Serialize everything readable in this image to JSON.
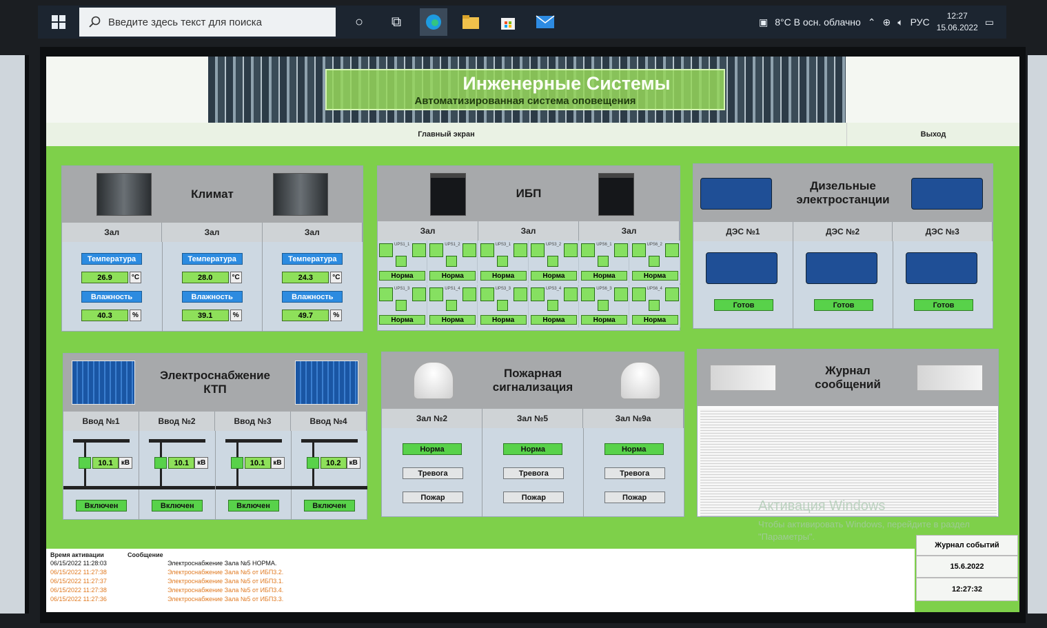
{
  "taskbar": {
    "search_placeholder": "Введите здесь текст для поиска",
    "weather": "8°C  В осн. облачно",
    "lang": "РУС",
    "time": "12:27",
    "date": "15.06.2022"
  },
  "header": {
    "title": "Инженерные Системы",
    "subtitle": "Автоматизированная система оповещения"
  },
  "nav": {
    "main": "Главный экран",
    "exit": "Выход"
  },
  "climate": {
    "title": "Климат",
    "columns": [
      {
        "name": "Зал",
        "temp_label": "Температура",
        "temp": "26.9",
        "temp_unit": "°C",
        "hum_label": "Влажность",
        "hum": "40.3",
        "hum_unit": "%"
      },
      {
        "name": "Зал",
        "temp_label": "Температура",
        "temp": "28.0",
        "temp_unit": "°C",
        "hum_label": "Влажность",
        "hum": "39.1",
        "hum_unit": "%"
      },
      {
        "name": "Зал",
        "temp_label": "Температура",
        "temp": "24.3",
        "temp_unit": "°C",
        "hum_label": "Влажность",
        "hum": "49.7",
        "hum_unit": "%"
      }
    ]
  },
  "ups": {
    "title": "ИБП",
    "columns": [
      "Зал",
      "Зал",
      "Зал"
    ],
    "rows": [
      [
        "Норма",
        "Норма",
        "Норма",
        "Норма",
        "Норма",
        "Норма"
      ],
      [
        "Норма",
        "Норма",
        "Норма",
        "Норма",
        "Норма",
        "Норма"
      ]
    ],
    "tags": [
      [
        "UPS1_1",
        "UPS1_2",
        "UPS3_1",
        "UPS3_2",
        "UPS6_1",
        "UPS6_2"
      ],
      [
        "UPS1_3",
        "UPS1_4",
        "UPS3_3",
        "UPS3_4",
        "UPS6_3",
        "UPS6_4"
      ]
    ]
  },
  "diesel": {
    "title": "Дизельные электростанции",
    "columns": [
      {
        "name": "ДЭС №1",
        "state": "Готов"
      },
      {
        "name": "ДЭС №2",
        "state": "Готов"
      },
      {
        "name": "ДЭС №3",
        "state": "Готов"
      }
    ]
  },
  "power": {
    "title": "Электроснабжение КТП",
    "columns": [
      {
        "name": "Ввод №1",
        "voltage": "10.1",
        "unit": "кВ",
        "state": "Включен"
      },
      {
        "name": "Ввод №2",
        "voltage": "10.1",
        "unit": "кВ",
        "state": "Включен"
      },
      {
        "name": "Ввод №3",
        "voltage": "10.1",
        "unit": "кВ",
        "state": "Включен"
      },
      {
        "name": "Ввод №4",
        "voltage": "10.2",
        "unit": "кВ",
        "state": "Включен"
      }
    ]
  },
  "fire": {
    "title": "Пожарная сигнализация",
    "columns": [
      {
        "name": "Зал №2",
        "norm": "Норма",
        "alarm": "Тревога",
        "fire": "Пожар"
      },
      {
        "name": "Зал №5",
        "norm": "Норма",
        "alarm": "Тревога",
        "fire": "Пожар"
      },
      {
        "name": "Зал №9а",
        "norm": "Норма",
        "alarm": "Тревога",
        "fire": "Пожар"
      }
    ]
  },
  "journal": {
    "title": "Журнал сообщений"
  },
  "log": {
    "col_time": "Время активации",
    "col_msg": "Сообщение",
    "rows": [
      {
        "time": "06/15/2022 11:28:03",
        "msg": "Электроснабжение Зала №5 НОРМА.",
        "color": "#111111"
      },
      {
        "time": "06/15/2022 11:27:38",
        "msg": "Электроснабжение Зала №5 от ИБП3.2.",
        "color": "#e07a22"
      },
      {
        "time": "06/15/2022 11:27:37",
        "msg": "Электроснабжение Зала №5 от ИБП3.1.",
        "color": "#e07a22"
      },
      {
        "time": "06/15/2022 11:27:38",
        "msg": "Электроснабжение Зала №5 от ИБП3.4.",
        "color": "#e07a22"
      },
      {
        "time": "06/15/2022 11:27:36",
        "msg": "Электроснабжение Зала №5 от ИБП3.3.",
        "color": "#e07a22"
      }
    ]
  },
  "side": {
    "journal": "Журнал событий",
    "date": "15.6.2022",
    "time": "12:27:32"
  },
  "watermark": {
    "line1": "Активация Windows",
    "line2": "Чтобы активировать Windows, перейдите в раздел \"Параметры\"."
  }
}
